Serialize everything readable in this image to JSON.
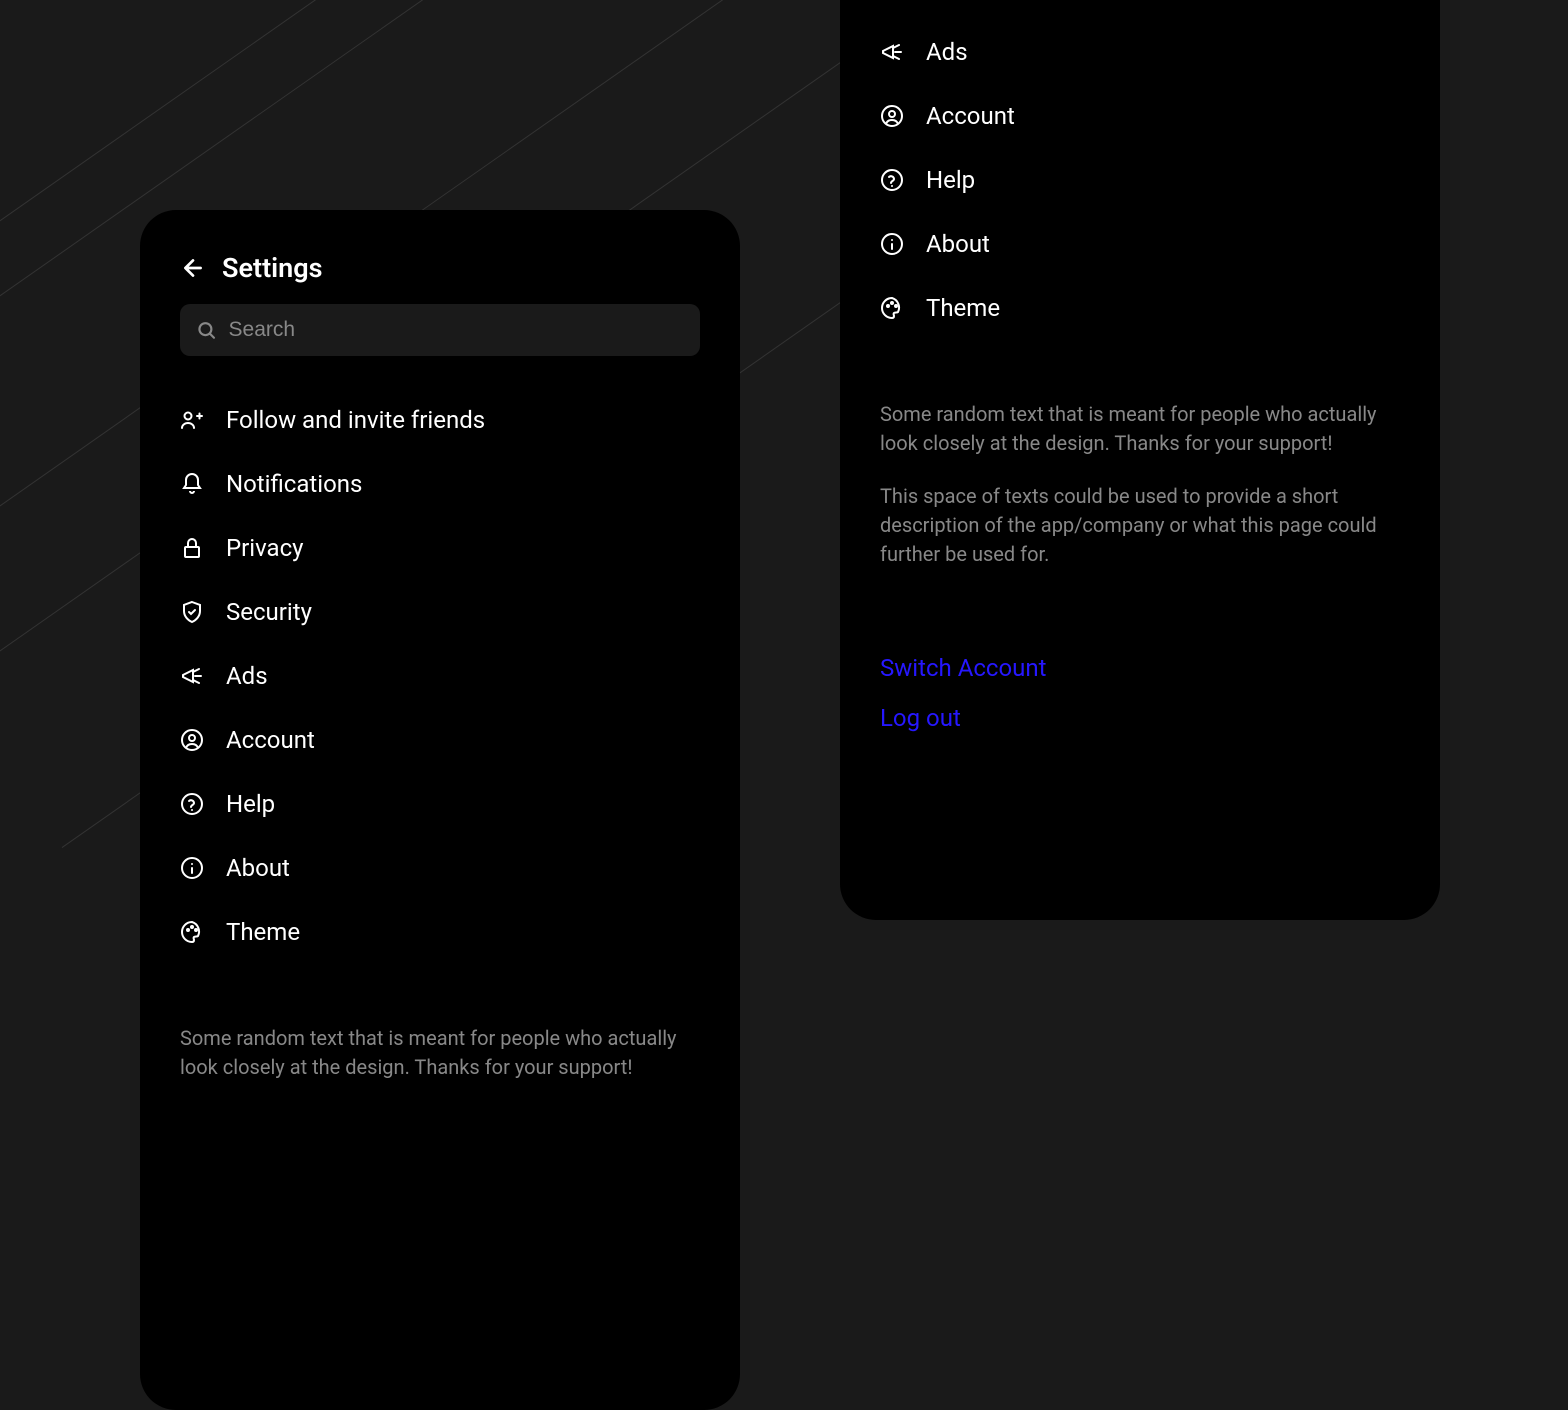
{
  "header": {
    "title": "Settings"
  },
  "search": {
    "placeholder": "Search"
  },
  "menu_items": [
    {
      "label": "Follow and invite friends",
      "icon": "user-plus"
    },
    {
      "label": "Notifications",
      "icon": "bell"
    },
    {
      "label": "Privacy",
      "icon": "lock"
    },
    {
      "label": "Security",
      "icon": "shield"
    },
    {
      "label": "Ads",
      "icon": "megaphone"
    },
    {
      "label": "Account",
      "icon": "account-circle"
    },
    {
      "label": "Help",
      "icon": "help"
    },
    {
      "label": "About",
      "icon": "info"
    },
    {
      "label": "Theme",
      "icon": "palette"
    }
  ],
  "footer": {
    "paragraph1": "Some random text that is meant for people who actually look closely at the design. Thanks for your support!",
    "paragraph2": "This space of texts could be used to provide a short description of the app/company or what this page could further be used for."
  },
  "actions": {
    "switch": "Switch Account",
    "logout": "Log out"
  }
}
